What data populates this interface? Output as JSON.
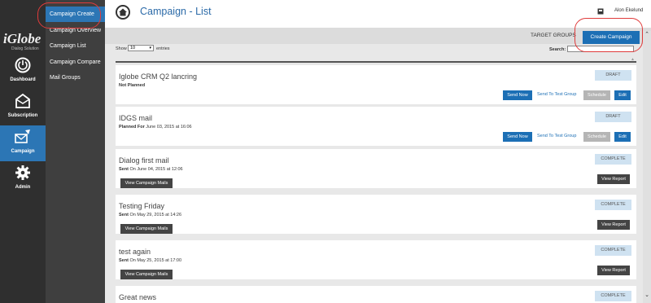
{
  "brand": {
    "logo_text": "iGlobe",
    "tagline": "Dialog Solution"
  },
  "rail": [
    {
      "label": "Dashboard",
      "icon": "dashboard-icon"
    },
    {
      "label": "Subscription",
      "icon": "envelope-icon"
    },
    {
      "label": "Campaign",
      "icon": "campaign-mail-icon"
    },
    {
      "label": "Admin",
      "icon": "gear-icon"
    }
  ],
  "submenu": [
    {
      "label": "Campaign Create"
    },
    {
      "label": "Campaign Overview"
    },
    {
      "label": "Campaign List"
    },
    {
      "label": "Campaign Compare"
    },
    {
      "label": "Mail Groups"
    }
  ],
  "header": {
    "title": "Campaign - List",
    "user_name": "Alon Ekelund"
  },
  "actionbar": {
    "target_groups": "TARGET GROUPS",
    "create_button": "Create Campaign"
  },
  "table": {
    "show_label": "Show",
    "page_size": "10",
    "entries_label": "entries",
    "search_label": "Search:"
  },
  "campaigns": [
    {
      "name": "Iglobe CRM Q2 lancring",
      "meta_bold": "Not Planned",
      "meta_rest": "",
      "status": "DRAFT",
      "send_now": "Send Now",
      "send_test": "Send To Test Group",
      "schedule": "Schedule",
      "edit": "Edit"
    },
    {
      "name": "IDGS mail",
      "meta_bold": "Planned For",
      "meta_rest": " June 03, 2015 at 16:06",
      "status": "DRAFT",
      "send_now": "Send Now",
      "send_test": "Send To Test Group",
      "schedule": "Schedule",
      "edit": "Edit"
    },
    {
      "name": "Dialog first mail",
      "meta_bold": "Sent",
      "meta_rest": " On June 04, 2015 at 12:06",
      "status": "COMPLETE",
      "view_mails": "View Campaign Mails",
      "view_report": "View Report"
    },
    {
      "name": "Testing Friday",
      "meta_bold": "Sent",
      "meta_rest": " On May 29, 2015 at 14:26",
      "status": "COMPLETE",
      "view_mails": "View Campaign Mails",
      "view_report": "View Report"
    },
    {
      "name": "test again",
      "meta_bold": "Sent",
      "meta_rest": " On May 25, 2015 at 17:00",
      "status": "COMPLETE",
      "view_mails": "View Campaign Mails",
      "view_report": "View Report"
    },
    {
      "name": "Great news",
      "status": "COMPLETE"
    }
  ],
  "colors": {
    "accent": "#2c76b5",
    "highlight": "#e03b3b",
    "rail_bg": "#2f2f2f",
    "submenu_bg": "#3f3f3f"
  }
}
